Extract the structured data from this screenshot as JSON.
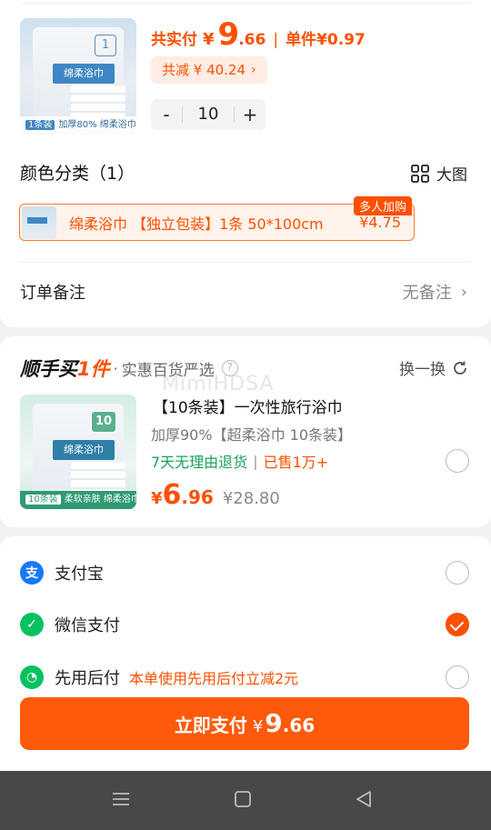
{
  "product": {
    "thumb_label": "绵柔浴巾",
    "thumb_num": "1",
    "thumb_strip_tag": "1条装",
    "thumb_strip_text": "加厚80% 绵柔浴巾",
    "total_label": "共实付",
    "currency": "¥",
    "total_int": "9",
    "total_dec": ".66",
    "unit_label": "单件",
    "unit_price": "¥0.97",
    "discount": "共减 ¥ 40.24",
    "quantity": "10",
    "minus": "-",
    "plus": "+"
  },
  "variants": {
    "title": "颜色分类（1）",
    "bigview_label": "大图",
    "selected_text": "绵柔浴巾 【独立包装】1条 50*100cm",
    "selected_price": "¥4.75",
    "selected_badge": "多人加购"
  },
  "remark": {
    "label": "订单备注",
    "value": "无备注"
  },
  "bundle": {
    "brand_prefix": "顺手买",
    "brand_emph": "1件",
    "subtitle": "实惠百货严选",
    "swap_label": "换一换",
    "thumb_label": "绵柔浴巾",
    "thumb_num": "10",
    "thumb_strip_tag": "10条装",
    "thumb_strip_text": "柔软亲肤 绵柔浴巾",
    "title": "【10条装】一次性旅行浴巾",
    "sub": "加厚90%【超柔浴巾 10条装】",
    "tag_green": "7天无理由退货",
    "tag_sold": "已售1万+",
    "price_yen": "¥",
    "price_int": "6",
    "price_dec": ".96",
    "orig_price": "¥28.80"
  },
  "payment": {
    "methods": [
      {
        "label": "支付宝",
        "icon": "alipay-icon",
        "color": "#1677ff",
        "checked": false
      },
      {
        "label": "微信支付",
        "icon": "wechat-pay-icon",
        "color": "#07c160",
        "checked": true
      },
      {
        "label": "先用后付",
        "icon": "pay-later-icon",
        "color": "#07c160",
        "checked": false,
        "promo": "本单使用先用后付立减2元"
      }
    ],
    "button_label": "立即支付",
    "button_yen": "¥",
    "button_int": "9",
    "button_dec": ".66"
  },
  "watermark": "MimiHDSA",
  "colors": {
    "accent": "#ff5000",
    "green": "#19a35a",
    "navbar": "#4a4847"
  }
}
